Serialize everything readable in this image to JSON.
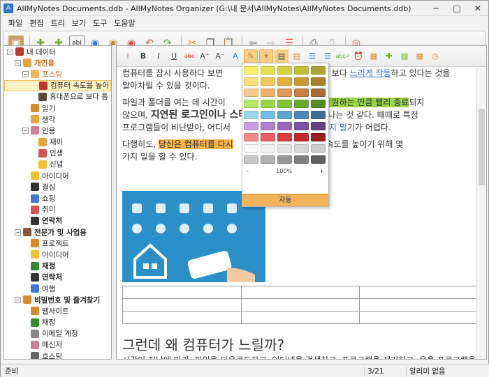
{
  "window": {
    "title": "AllMyNotes Documents.ddb - AllMyNotes Organizer (G:\\내 문서\\AllMyNotes\\AllMyNotes Documents.ddb)"
  },
  "menu": [
    "파일",
    "편집",
    "트리",
    "보기",
    "도구",
    "도움말"
  ],
  "sidebar": {
    "items": [
      {
        "label": "내 데이터",
        "level": 0,
        "icon": "books-icon",
        "color": "#c0392b",
        "bold": false
      },
      {
        "label": "개인용",
        "level": 1,
        "icon": "smile-icon",
        "color": "#e8a23a",
        "bold": true,
        "orange": true
      },
      {
        "label": "포스팅",
        "level": 2,
        "icon": "folder-icon",
        "color": "#f0b85a",
        "bold": false,
        "orange": true
      },
      {
        "label": "컴퓨터 속도를 높이",
        "level": 3,
        "icon": "note-icon",
        "color": "#c0392b",
        "selected": true
      },
      {
        "label": "휴대폰으로 보다 틈",
        "level": 3,
        "icon": "note-icon",
        "color": "#5a4a3a"
      },
      {
        "label": "일기",
        "level": 2,
        "icon": "book-icon",
        "color": "#d98a2b"
      },
      {
        "label": "생각",
        "level": 2,
        "icon": "arrow-icon",
        "color": "#e8a23a"
      },
      {
        "label": "인용",
        "level": 2,
        "icon": "quote-icon",
        "color": "#d47a9a"
      },
      {
        "label": "재미",
        "level": 3,
        "icon": "smile-icon",
        "color": "#e8a23a"
      },
      {
        "label": "인생",
        "level": 3,
        "icon": "heart-icon",
        "color": "#d9534f"
      },
      {
        "label": "신념",
        "level": 3,
        "icon": "bulb-icon",
        "color": "#f0c030"
      },
      {
        "label": "아이디어",
        "level": 2,
        "icon": "bulb-icon",
        "color": "#f0c030"
      },
      {
        "label": "결심",
        "level": 2,
        "icon": "diamond-icon",
        "color": "#333333"
      },
      {
        "label": "쇼핑",
        "level": 2,
        "icon": "cart-icon",
        "color": "#3a7bd5"
      },
      {
        "label": "취미",
        "level": 2,
        "icon": "apple-icon",
        "color": "#d9534f"
      },
      {
        "label": "연락처",
        "level": 2,
        "icon": "contact-icon",
        "color": "#333333",
        "bold": true
      },
      {
        "label": "전문가 및 사업용",
        "level": 1,
        "icon": "handshake-icon",
        "color": "#8a5a2a",
        "bold": true
      },
      {
        "label": "프로젝트",
        "level": 2,
        "icon": "pencil-icon",
        "color": "#d98a2b"
      },
      {
        "label": "아이디어",
        "level": 2,
        "icon": "bulb-icon",
        "color": "#f0c030"
      },
      {
        "label": "재정",
        "level": 2,
        "icon": "dollar-icon",
        "color": "#2e8b2e",
        "bold": true
      },
      {
        "label": "연락처",
        "level": 2,
        "icon": "contact-icon",
        "color": "#333333",
        "bold": true
      },
      {
        "label": "여행",
        "level": 2,
        "icon": "suitcase-icon",
        "color": "#3a7bd5"
      },
      {
        "label": "비밀번호 및 즐겨찾기",
        "level": 1,
        "icon": "key-icon",
        "color": "#d98a2b",
        "bold": true
      },
      {
        "label": "웹사이트",
        "level": 2,
        "icon": "globe-icon",
        "color": "#d98a2b"
      },
      {
        "label": "재정",
        "level": 2,
        "icon": "dollar-icon",
        "color": "#2e8b2e"
      },
      {
        "label": "이메일 계정",
        "level": 2,
        "icon": "mail-icon",
        "color": "#888888"
      },
      {
        "label": "메신저",
        "level": 2,
        "icon": "quote-icon",
        "color": "#d47a9a"
      },
      {
        "label": "호스팅",
        "level": 2,
        "icon": "server-icon",
        "color": "#666666"
      },
      {
        "label": "휴지통",
        "level": 1,
        "icon": "trash-icon",
        "color": "#3a7bd5",
        "bold": true
      }
    ]
  },
  "content": {
    "p1a": "컴퓨터를 잠시 사용하다 보면 ",
    "p1b": "보다 ",
    "p1c": "느리게 작동",
    "p1d": "하고 있다는 것을",
    "p1e": "알아차릴 수 있을 것이다.",
    "p2a": "파일과 폴더를 여는 데 시간이 ",
    "p2b": "로그램이 원하는 만큼 빨리 종료",
    "p2c": "되지",
    "p2d": "않으며, ",
    "p2e": "지연된 로그인이나 스타",
    "p2f": "어나는 것 같다. 때때로 특정",
    "p2g": "프로그램들이 비난받아, 어디서",
    "p2h": "해야 할지 알",
    "p2i": "기가 어렵다.",
    "p3a": "다행히도, ",
    "p3b": "당신은 컴퓨터를 다시",
    "p3c": "게 하기 위해 속도를 높이기 위해 몇",
    "p3d": "가지 일을 할 수 있다.",
    "heading": "그런데 왜 컴퓨터가 느릴까?",
    "para": "시간이 지남에 따라, 파일을 다운로드하고, 인터넷을 검색하고, 프로그램을 제거하고, 응용 프로그램을 열어두고, 컴퓨터에서 거의 모든 것을 할 때, 그것은 서서히 잡동사니를 수집하고, 처음에는 항상 쉽지만은 않은 막후 문제를 일으킨다."
  },
  "palette": {
    "zoom_minus": "-",
    "zoom_value": "100%",
    "zoom_plus": "+",
    "auto_label": "자동",
    "rows": [
      [
        "#f7f06a",
        "#e6e050",
        "#d6d045",
        "#c4bf3a",
        "#aaa532"
      ],
      [
        "#f8e07a",
        "#f0c85a",
        "#e0b040",
        "#c99a32",
        "#a8822a"
      ],
      [
        "#f7c98a",
        "#f0b070",
        "#e09858",
        "#c87f48",
        "#a86a3a"
      ],
      [
        "#b6e86a",
        "#9ad84a",
        "#84c23a",
        "#6aa82e",
        "#558a24"
      ],
      [
        "#9ad8e8",
        "#78c0e0",
        "#5aa6d0",
        "#4a8ab8",
        "#3a6e98"
      ],
      [
        "#c8a0e0",
        "#b082d0",
        "#9868c0",
        "#7e52a6",
        "#664086"
      ],
      [
        "#f08a8a",
        "#e86060",
        "#d84040",
        "#c02a2a",
        "#9a1e1e"
      ],
      [
        "#f8f8f8",
        "#f0f0f0",
        "#e4e4e4",
        "#d8d8d8",
        "#cccccc"
      ],
      [
        "#c8c8c8",
        "#b0b0b0",
        "#989898",
        "#808080",
        "#606060"
      ]
    ]
  },
  "status": {
    "left": "준비",
    "page": "3/21",
    "alarm": "알리미 없음"
  }
}
